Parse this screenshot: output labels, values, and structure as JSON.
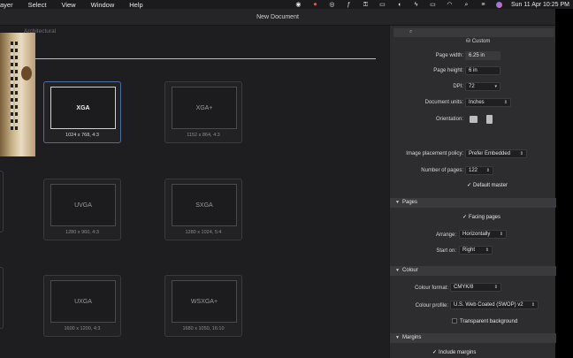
{
  "menubar": {
    "items": [
      "ayer",
      "Select",
      "View",
      "Window",
      "Help"
    ],
    "clock": "Sun 11 Apr  10:25 PM"
  },
  "window": {
    "title": "New Document"
  },
  "tabs": [
    "Architectural"
  ],
  "presets": [
    {
      "name": "XGA",
      "dims": "1024 x 768, 4:3",
      "selected": true
    },
    {
      "name": "XGA+",
      "dims": "1152 x 864, 4:3",
      "selected": false
    },
    {
      "name": "UVGA",
      "dims": "1280 x 960, 4:3",
      "selected": false
    },
    {
      "name": "SXGA",
      "dims": "1280 x 1024, 5:4",
      "selected": false
    },
    {
      "name": "UXGA",
      "dims": "1600 x 1200, 4:3",
      "selected": false
    },
    {
      "name": "WSXGA+",
      "dims": "1680 x 1050, 16:10",
      "selected": false
    }
  ],
  "panel": {
    "preset_name": "Custom",
    "page_width_label": "Page width:",
    "page_width": "6.25 in",
    "page_height_label": "Page height:",
    "page_height": "6 in",
    "dpi_label": "DPI:",
    "dpi": "72",
    "units_label": "Document units:",
    "units": "Inches",
    "orientation_label": "Orientation:",
    "placement_label": "Image placement policy:",
    "placement": "Prefer Embedded",
    "num_pages_label": "Number of pages:",
    "num_pages": "122",
    "default_master": "Default master",
    "pages_section": "Pages",
    "facing_pages": "Facing pages",
    "arrange_label": "Arrange:",
    "arrange": "Horizontally",
    "start_on_label": "Start on:",
    "start_on": "Right",
    "colour_section": "Colour",
    "colour_format_label": "Colour format:",
    "colour_format": "CMYK/8",
    "colour_profile_label": "Colour profile:",
    "colour_profile": "U.S. Web Coated (SWOP) v2",
    "transparent_bg": "Transparent background",
    "margins_section": "Margins",
    "include_margins": "Include margins"
  },
  "colors": {
    "selected_border": "#4f6e9e",
    "panel_bg": "#2d2d30",
    "dialog_bg": "#1e1e20"
  }
}
